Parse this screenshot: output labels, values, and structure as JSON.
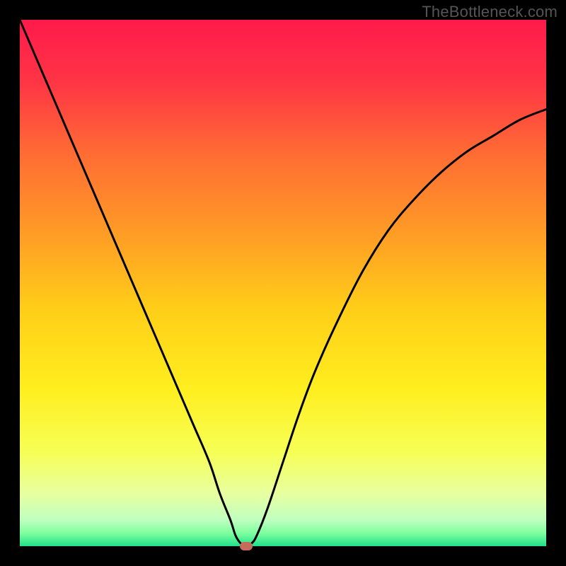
{
  "watermark": "TheBottleneck.com",
  "chart_data": {
    "type": "line",
    "title": "",
    "xlabel": "",
    "ylabel": "",
    "xlim": [
      0,
      100
    ],
    "ylim": [
      0,
      100
    ],
    "grid": false,
    "legend": false,
    "background": {
      "type": "vertical-gradient",
      "stops": [
        {
          "pos": 0.0,
          "color": "#ff1a4b"
        },
        {
          "pos": 0.12,
          "color": "#ff3545"
        },
        {
          "pos": 0.25,
          "color": "#ff6a34"
        },
        {
          "pos": 0.4,
          "color": "#ff9a26"
        },
        {
          "pos": 0.55,
          "color": "#ffce18"
        },
        {
          "pos": 0.7,
          "color": "#ffee1e"
        },
        {
          "pos": 0.82,
          "color": "#f6ff55"
        },
        {
          "pos": 0.9,
          "color": "#e8ffa0"
        },
        {
          "pos": 0.95,
          "color": "#c0ffc0"
        },
        {
          "pos": 0.975,
          "color": "#7fff9f"
        },
        {
          "pos": 1.0,
          "color": "#21e08a"
        }
      ]
    },
    "series": [
      {
        "name": "bottleneck-curve",
        "color": "#000000",
        "x": [
          0,
          3,
          6,
          9,
          12,
          15,
          18,
          21,
          24,
          27,
          30,
          33,
          36,
          38,
          40,
          41,
          42,
          43,
          44,
          45,
          47,
          50,
          53,
          56,
          60,
          65,
          70,
          75,
          80,
          85,
          90,
          95,
          100
        ],
        "y": [
          100,
          93,
          86,
          79,
          72,
          65,
          58,
          51,
          44,
          37,
          30,
          23,
          16,
          10,
          5,
          2,
          0.5,
          0,
          0.5,
          2,
          7,
          16,
          25,
          33,
          42,
          52,
          60,
          66,
          71,
          75,
          78,
          81,
          83
        ]
      }
    ],
    "markers": [
      {
        "name": "optimum-point",
        "x": 43,
        "y": 0,
        "color": "#c76b5a"
      }
    ]
  }
}
